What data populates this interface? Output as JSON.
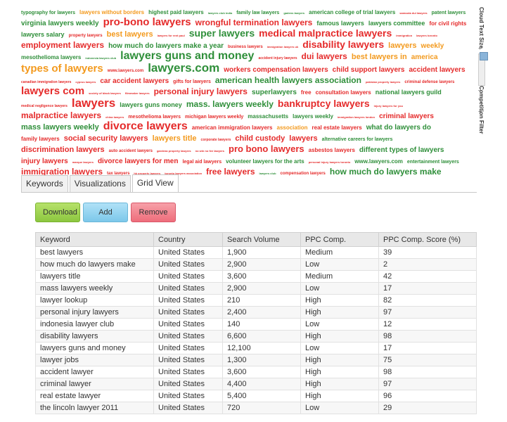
{
  "cloud": {
    "words": [
      {
        "t": "typography for lawyers",
        "s": 7,
        "c": "#2f8f3a"
      },
      {
        "t": "lawyers without borders",
        "s": 8,
        "c": "#f39a1e"
      },
      {
        "t": "highest paid lawyers",
        "s": 8,
        "c": "#2f8f3a"
      },
      {
        "t": "lawyers club india",
        "s": 4,
        "c": "#2f8f3a"
      },
      {
        "t": "family law lawyers",
        "s": 7,
        "c": "#2f8f3a"
      },
      {
        "t": "gadens lawyers",
        "s": 4,
        "c": "#2f8f3a"
      },
      {
        "t": "american college of trial lawyers",
        "s": 8,
        "c": "#2f8f3a"
      },
      {
        "t": "sarasota dui lawyers",
        "s": 4,
        "c": "#e52b2b"
      },
      {
        "t": "patent lawyers",
        "s": 7,
        "c": "#2f8f3a"
      },
      {
        "t": "virginia lawyers weekly",
        "s": 10,
        "c": "#2f8f3a"
      },
      {
        "t": "pro-bono lawyers",
        "s": 15,
        "c": "#e52b2b"
      },
      {
        "t": "wrongful termination lawyers",
        "s": 12,
        "c": "#e52b2b"
      },
      {
        "t": "famous lawyers",
        "s": 9,
        "c": "#2f8f3a"
      },
      {
        "t": "lawyers committee",
        "s": 9,
        "c": "#2f8f3a"
      },
      {
        "t": "for civil rights",
        "s": 8,
        "c": "#e52b2b"
      },
      {
        "t": "lawyers salary",
        "s": 9,
        "c": "#2f8f3a"
      },
      {
        "t": "property lawyers",
        "s": 6,
        "c": "#e52b2b"
      },
      {
        "t": "best lawyers",
        "s": 11,
        "c": "#f39a1e"
      },
      {
        "t": "lawyers for rent paul",
        "s": 4,
        "c": "#e52b2b"
      },
      {
        "t": "super lawyers",
        "s": 14,
        "c": "#2f8f3a"
      },
      {
        "t": "medical malpractice lawyers",
        "s": 14,
        "c": "#e52b2b"
      },
      {
        "t": "immigration",
        "s": 4,
        "c": "#e52b2b"
      },
      {
        "t": "lawyers toronto",
        "s": 4,
        "c": "#e52b2b"
      },
      {
        "t": "employment lawyers",
        "s": 12,
        "c": "#e52b2b"
      },
      {
        "t": "how much do lawyers make a year",
        "s": 10,
        "c": "#2f8f3a"
      },
      {
        "t": "business lawyers",
        "s": 6,
        "c": "#e52b2b"
      },
      {
        "t": "immigration lawyers uk",
        "s": 4,
        "c": "#e52b2b"
      },
      {
        "t": "disability lawyers",
        "s": 14,
        "c": "#e52b2b"
      },
      {
        "t": "lawyers",
        "s": 11,
        "c": "#f39a1e"
      },
      {
        "t": "weekly",
        "s": 10,
        "c": "#f39a1e"
      },
      {
        "t": "mesothelioma lawyers",
        "s": 8,
        "c": "#2f8f3a"
      },
      {
        "t": "indonesia lawyers club",
        "s": 4,
        "c": "#2f8f3a"
      },
      {
        "t": "lawyers guns and money",
        "s": 16,
        "c": "#2f8f3a"
      },
      {
        "t": "accident injury lawyers",
        "s": 5,
        "c": "#e52b2b"
      },
      {
        "t": "dui lawyers",
        "s": 12,
        "c": "#e52b2b"
      },
      {
        "t": "best lawyers in",
        "s": 11,
        "c": "#f39a1e"
      },
      {
        "t": "america",
        "s": 10,
        "c": "#f39a1e"
      },
      {
        "t": "types of lawyers",
        "s": 15,
        "c": "#f39a1e"
      },
      {
        "t": "www.lawyers.com",
        "s": 6,
        "c": "#e52b2b"
      },
      {
        "t": "lawyers.com",
        "s": 17,
        "c": "#2f8f3a"
      },
      {
        "t": "workers compensation lawyers",
        "s": 10,
        "c": "#e52b2b"
      },
      {
        "t": "child support lawyers",
        "s": 10,
        "c": "#e52b2b"
      },
      {
        "t": "accident lawyers",
        "s": 10,
        "c": "#e52b2b"
      },
      {
        "t": "canadian immigration lawyers",
        "s": 5,
        "c": "#e52b2b"
      },
      {
        "t": "cyprus lawyers",
        "s": 4,
        "c": "#e52b2b"
      },
      {
        "t": "car accident lawyers",
        "s": 10,
        "c": "#e52b2b"
      },
      {
        "t": "gifts for lawyers",
        "s": 7,
        "c": "#e52b2b"
      },
      {
        "t": "american health lawyers association",
        "s": 12,
        "c": "#2f8f3a"
      },
      {
        "t": "pakistan property lawyers",
        "s": 4,
        "c": "#e52b2b"
      },
      {
        "t": "criminal defense lawyers",
        "s": 6,
        "c": "#e52b2b"
      },
      {
        "t": "lawyers com",
        "s": 15,
        "c": "#e52b2b"
      },
      {
        "t": "society of black lawyers",
        "s": 4,
        "c": "#e52b2b"
      },
      {
        "t": "filmmaker lawyers",
        "s": 4,
        "c": "#e52b2b"
      },
      {
        "t": "personal injury lawyers",
        "s": 12,
        "c": "#e52b2b"
      },
      {
        "t": "superlawyers",
        "s": 10,
        "c": "#2f8f3a"
      },
      {
        "t": "free",
        "s": 8,
        "c": "#e52b2b"
      },
      {
        "t": "consultation lawyers",
        "s": 8,
        "c": "#e52b2b"
      },
      {
        "t": "national lawyers guild",
        "s": 9,
        "c": "#2f8f3a"
      },
      {
        "t": "medical negligence lawyers",
        "s": 5,
        "c": "#e52b2b"
      },
      {
        "t": "lawyers",
        "s": 17,
        "c": "#e52b2b"
      },
      {
        "t": "lawyers guns money",
        "s": 9,
        "c": "#2f8f3a"
      },
      {
        "t": "mass. lawyers weekly",
        "s": 12,
        "c": "#2f8f3a"
      },
      {
        "t": "bankruptcy lawyers",
        "s": 14,
        "c": "#e52b2b"
      },
      {
        "t": "injury lawyers for you",
        "s": 4,
        "c": "#e52b2b"
      },
      {
        "t": "malpractice lawyers",
        "s": 12,
        "c": "#e52b2b"
      },
      {
        "t": "china lawyers",
        "s": 4,
        "c": "#e52b2b"
      },
      {
        "t": "mesothelioma lawyers",
        "s": 7,
        "c": "#e52b2b"
      },
      {
        "t": "michigan lawyers weekly",
        "s": 7,
        "c": "#e52b2b"
      },
      {
        "t": "massachusetts",
        "s": 8,
        "c": "#2f8f3a"
      },
      {
        "t": "lawyers weekly",
        "s": 8,
        "c": "#2f8f3a"
      },
      {
        "t": "immigration lawyers london",
        "s": 4,
        "c": "#e52b2b"
      },
      {
        "t": "criminal lawyers",
        "s": 10,
        "c": "#e52b2b"
      },
      {
        "t": "mass lawyers weekly",
        "s": 11,
        "c": "#2f8f3a"
      },
      {
        "t": "divorce lawyers",
        "s": 16,
        "c": "#e52b2b"
      },
      {
        "t": "american immigration lawyers",
        "s": 8,
        "c": "#e52b2b"
      },
      {
        "t": "association",
        "s": 8,
        "c": "#f39a1e"
      },
      {
        "t": "real estate lawyers",
        "s": 8,
        "c": "#e52b2b"
      },
      {
        "t": "what do lawyers do",
        "s": 10,
        "c": "#2f8f3a"
      },
      {
        "t": "family lawyers",
        "s": 8,
        "c": "#e52b2b"
      },
      {
        "t": "social security lawyers",
        "s": 11,
        "c": "#e52b2b"
      },
      {
        "t": "lawyers title",
        "s": 11,
        "c": "#f39a1e"
      },
      {
        "t": "corporate lawyers",
        "s": 5,
        "c": "#e52b2b"
      },
      {
        "t": "child custody",
        "s": 11,
        "c": "#e52b2b"
      },
      {
        "t": "lawyers",
        "s": 11,
        "c": "#e52b2b"
      },
      {
        "t": "alternative careers for lawyers",
        "s": 7,
        "c": "#2f8f3a"
      },
      {
        "t": "discrimination lawyers",
        "s": 11,
        "c": "#e52b2b"
      },
      {
        "t": "auto accident lawyers",
        "s": 6,
        "c": "#e52b2b"
      },
      {
        "t": "gardena property lawyers",
        "s": 4,
        "c": "#e52b2b"
      },
      {
        "t": "no win no fee lawyers",
        "s": 4,
        "c": "#e52b2b"
      },
      {
        "t": "pro bono lawyers",
        "s": 13,
        "c": "#e52b2b"
      },
      {
        "t": "asbestos lawyers",
        "s": 8,
        "c": "#e52b2b"
      },
      {
        "t": "different types of lawyers",
        "s": 10,
        "c": "#2f8f3a"
      },
      {
        "t": "injury lawyers",
        "s": 10,
        "c": "#e52b2b"
      },
      {
        "t": "marque lawyers",
        "s": 4,
        "c": "#e52b2b"
      },
      {
        "t": "divorce lawyers for men",
        "s": 10,
        "c": "#e52b2b"
      },
      {
        "t": "legal aid lawyers",
        "s": 7,
        "c": "#e52b2b"
      },
      {
        "t": "volunteer lawyers for the arts",
        "s": 8,
        "c": "#2f8f3a"
      },
      {
        "t": "personal injury lawyers toronto",
        "s": 4,
        "c": "#e52b2b"
      },
      {
        "t": "www.lawyers.com",
        "s": 8,
        "c": "#2f8f3a"
      },
      {
        "t": "entertainment lawyers",
        "s": 7,
        "c": "#2f8f3a"
      },
      {
        "t": "immigration lawyers",
        "s": 12,
        "c": "#e52b2b"
      },
      {
        "t": "tax lawyers",
        "s": 6,
        "c": "#e52b2b"
      },
      {
        "t": "hk property lawyers",
        "s": 4,
        "c": "#e52b2b"
      },
      {
        "t": "toronto lawyers association",
        "s": 4,
        "c": "#e52b2b"
      },
      {
        "t": "free lawyers",
        "s": 12,
        "c": "#e52b2b"
      },
      {
        "t": "lawyers club",
        "s": 4,
        "c": "#2f8f3a"
      },
      {
        "t": "compensation lawyers",
        "s": 6,
        "c": "#e52b2b"
      },
      {
        "t": "how much do lawyers make",
        "s": 12,
        "c": "#2f8f3a"
      }
    ]
  },
  "sidebar": {
    "cloud_text_size": "Cloud Text Size",
    "competition_filter": "Competition Filter"
  },
  "tabs": [
    {
      "label": "Keywords",
      "active": false
    },
    {
      "label": "Visualizations",
      "active": false
    },
    {
      "label": "Grid View",
      "active": true
    }
  ],
  "toolbar": {
    "download_label": "Download",
    "add_label": "Add",
    "remove_label": "Remove"
  },
  "grid": {
    "columns": [
      "Keyword",
      "Country",
      "Search Volume",
      "PPC Comp.",
      "PPC Comp. Score (%)"
    ],
    "rows": [
      [
        "best lawyers",
        "United States",
        "1,900",
        "Medium",
        "39"
      ],
      [
        "how much do lawyers make",
        "United States",
        "2,900",
        "Low",
        "2"
      ],
      [
        "lawyers title",
        "United States",
        "3,600",
        "Medium",
        "42"
      ],
      [
        "mass lawyers weekly",
        "United States",
        "2,900",
        "Low",
        "17"
      ],
      [
        "lawyer lookup",
        "United States",
        "210",
        "High",
        "82"
      ],
      [
        "personal injury lawyers",
        "United States",
        "2,400",
        "High",
        "97"
      ],
      [
        "indonesia lawyer club",
        "United States",
        "140",
        "Low",
        "12"
      ],
      [
        "disability lawyers",
        "United States",
        "6,600",
        "High",
        "98"
      ],
      [
        "lawyers guns and money",
        "United States",
        "12,100",
        "Low",
        "17"
      ],
      [
        "lawyer jobs",
        "United States",
        "1,300",
        "High",
        "75"
      ],
      [
        "accident lawyer",
        "United States",
        "3,600",
        "High",
        "98"
      ],
      [
        "criminal lawyer",
        "United States",
        "4,400",
        "High",
        "97"
      ],
      [
        "real estate lawyer",
        "United States",
        "5,400",
        "High",
        "96"
      ],
      [
        "the lincoln lawyer 2011",
        "United States",
        "720",
        "Low",
        "29"
      ]
    ]
  }
}
